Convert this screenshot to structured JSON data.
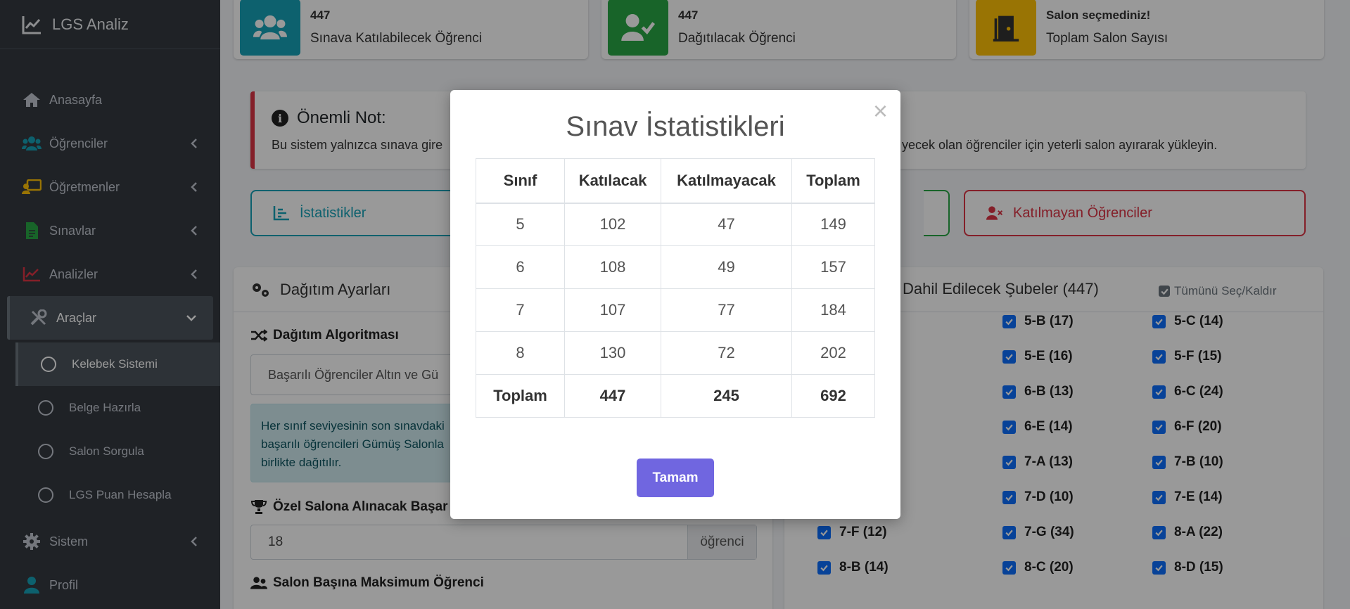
{
  "brand": {
    "title": "LGS Analiz"
  },
  "sidebar": {
    "items": [
      {
        "label": "Anasayfa"
      },
      {
        "label": "Öğrenciler"
      },
      {
        "label": "Öğretmenler"
      },
      {
        "label": "Sınavlar"
      },
      {
        "label": "Analizler"
      },
      {
        "label": "Araçlar"
      }
    ],
    "subitems": [
      {
        "label": "Kelebek Sistemi"
      },
      {
        "label": "Belge Hazırla"
      },
      {
        "label": "Salon Sorgula"
      },
      {
        "label": "LGS Puan Hesapla"
      }
    ],
    "bottom": [
      {
        "label": "Sistem"
      },
      {
        "label": "Profil"
      }
    ]
  },
  "stats": [
    {
      "number": "447",
      "label": "Sınava Katılabilecek Öğrenci",
      "color": "#17a2b8"
    },
    {
      "number": "447",
      "label": "Dağıtılacak Öğrenci",
      "color": "#28a745"
    },
    {
      "number": "Salon seçmediniz!",
      "label": "Toplam Salon Sayısı",
      "color": "#ffc107"
    }
  ],
  "note": {
    "title": "Önemli Not:",
    "text_left": "Bu sistem yalnızca sınava gire",
    "text_right": "yecek olan öğrenciler için yeterli salon ayırarak yükleyin."
  },
  "buttons": {
    "stats": "İstatistikler",
    "absent": "Katılmayan Öğrenciler"
  },
  "settings": {
    "title": "Dağıtım Ayarları",
    "algorithm_label": "Dağıtım Algoritması",
    "algorithm_value": "Başarılı Öğrenciler Altın ve Gü",
    "info_text": "Her sınıf seviyesinin son sınavdaki başarılı öğrencileri Gümüş Salonla birlikte dağıtılır.",
    "info_lines": [
      "Her sınıf seviyesinin son sınavdaki",
      "başarılı öğrencileri Gümüş Salonla",
      "birlikte dağıtılır."
    ],
    "special_label": "Özel Salona Alınacak Başar",
    "special_value": "18",
    "special_unit": "öğrenci",
    "max_label": "Salon Başına Maksimum Öğrenci"
  },
  "branches": {
    "title": "Dahil Edilecek Şubeler (447)",
    "select_all": "Tümünü Seç/Kaldır",
    "items": [
      "5-B (17)",
      "5-C (14)",
      "5-E (16)",
      "5-F (15)",
      "6-B (13)",
      "6-C (24)",
      "6-E (14)",
      "6-F (20)",
      "7-A (13)",
      "7-B (10)",
      "7-D (10)",
      "7-E (14)",
      "7-F (12)",
      "7-G (34)",
      "8-A (22)",
      "8-B (14)",
      "8-C (20)",
      "8-D (15)"
    ]
  },
  "modal": {
    "title": "Sınav İstatistikleri",
    "close": "×",
    "ok": "Tamam",
    "headers": [
      "Sınıf",
      "Katılacak",
      "Katılmayacak",
      "Toplam"
    ],
    "rows": [
      [
        "5",
        "102",
        "47",
        "149"
      ],
      [
        "6",
        "108",
        "49",
        "157"
      ],
      [
        "7",
        "107",
        "77",
        "184"
      ],
      [
        "8",
        "130",
        "72",
        "202"
      ]
    ],
    "total": [
      "Toplam",
      "447",
      "245",
      "692"
    ]
  }
}
